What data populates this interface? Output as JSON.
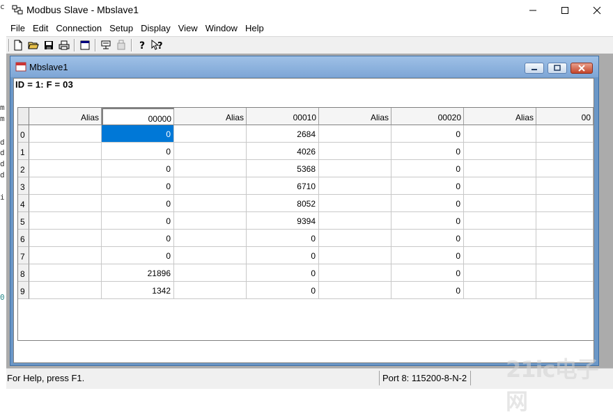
{
  "app": {
    "title": "Modbus Slave - Mbslave1",
    "icon": "modbus-app-icon"
  },
  "window_controls": {
    "minimize": "minimize-icon",
    "maximize": "maximize-icon",
    "close": "close-icon"
  },
  "menu": [
    "File",
    "Edit",
    "Connection",
    "Setup",
    "Display",
    "View",
    "Window",
    "Help"
  ],
  "toolbar": {
    "buttons": [
      "new-icon",
      "open-icon",
      "save-icon",
      "print-icon",
      "window-icon",
      "connect-icon",
      "disconnect-icon",
      "help-icon",
      "context-help-icon"
    ]
  },
  "child": {
    "title": "Mbslave1",
    "id_line": "ID = 1: F = 03"
  },
  "grid": {
    "columns": [
      "Alias",
      "00000",
      "Alias",
      "00010",
      "Alias",
      "00020",
      "Alias",
      "00"
    ],
    "row_numbers": [
      "0",
      "1",
      "2",
      "3",
      "4",
      "5",
      "6",
      "7",
      "8",
      "9"
    ],
    "values_col_00000": [
      "0",
      "0",
      "0",
      "0",
      "0",
      "0",
      "0",
      "0",
      "21896",
      "1342"
    ],
    "values_col_00010": [
      "2684",
      "4026",
      "5368",
      "6710",
      "8052",
      "9394",
      "0",
      "0",
      "0",
      "0"
    ],
    "values_col_00020": [
      "0",
      "0",
      "0",
      "0",
      "0",
      "0",
      "0",
      "0",
      "0",
      "0"
    ],
    "selected_cell": {
      "row": 0,
      "column": "00000"
    }
  },
  "status": {
    "help_text": "For Help, press F1.",
    "port_text": "Port 8: 115200-8-N-2"
  },
  "watermark": "21ic电子网",
  "colors": {
    "selection": "#0078d7",
    "child_frame": "#6b97c7",
    "mdi_background": "#ababab"
  }
}
